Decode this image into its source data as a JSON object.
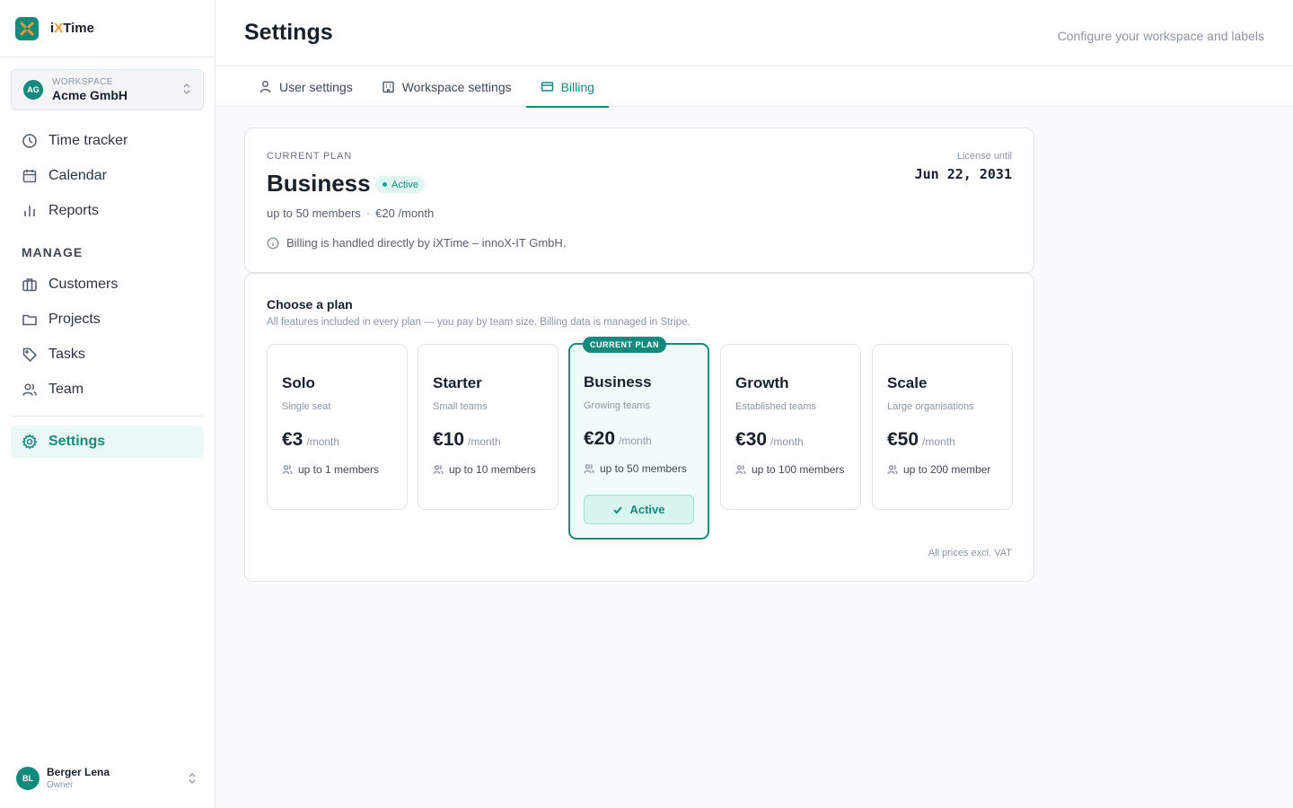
{
  "brand": {
    "prefix": "i",
    "x": "X",
    "suffix": "Time",
    "accent": "#f39a2c",
    "primary": "#148a7c"
  },
  "workspace": {
    "label": "WORKSPACE",
    "initials": "AG",
    "name": "Acme GmbH"
  },
  "nav": {
    "main": [
      {
        "label": "Time tracker",
        "icon": "clock-icon"
      },
      {
        "label": "Calendar",
        "icon": "calendar-icon"
      },
      {
        "label": "Reports",
        "icon": "bar-chart-icon"
      }
    ],
    "manage_label": "MANAGE",
    "manage": [
      {
        "label": "Customers",
        "icon": "briefcase-icon"
      },
      {
        "label": "Projects",
        "icon": "folder-icon"
      },
      {
        "label": "Tasks",
        "icon": "tag-icon"
      },
      {
        "label": "Team",
        "icon": "users-icon"
      }
    ],
    "settings": {
      "label": "Settings",
      "icon": "gear-icon",
      "active": true
    }
  },
  "user": {
    "initials": "BL",
    "name": "Berger Lena",
    "role": "Owner"
  },
  "header": {
    "title": "Settings",
    "subtitle": "Configure your workspace and labels"
  },
  "tabs": [
    {
      "label": "User settings",
      "icon": "user-icon"
    },
    {
      "label": "Workspace settings",
      "icon": "building-icon"
    },
    {
      "label": "Billing",
      "icon": "credit-card-icon",
      "active": true
    }
  ],
  "current_plan": {
    "label": "CURRENT PLAN",
    "name": "Business",
    "status": "Active",
    "members": "up to 50 members",
    "price": "€20 /month",
    "info": "Billing is handled directly by iXTime – innoX-IT GmbH.",
    "license_label": "License until",
    "license_date": "Jun 22, 2031"
  },
  "plans_section": {
    "title": "Choose a plan",
    "subtitle": "All features included in every plan — you pay by team size. Billing data is managed in Stripe.",
    "current_flag": "CURRENT PLAN",
    "active_button": "Active",
    "vat_note": "All prices excl. VAT",
    "plans": [
      {
        "name": "Solo",
        "desc": "Single seat",
        "price": "€3",
        "period": "/month",
        "members": "up to 1 members"
      },
      {
        "name": "Starter",
        "desc": "Small teams",
        "price": "€10",
        "period": "/month",
        "members": "up to 10 members"
      },
      {
        "name": "Business",
        "desc": "Growing teams",
        "price": "€20",
        "period": "/month",
        "members": "up to 50 members",
        "current": true
      },
      {
        "name": "Growth",
        "desc": "Established teams",
        "price": "€30",
        "period": "/month",
        "members": "up to 100 members"
      },
      {
        "name": "Scale",
        "desc": "Large organisations",
        "price": "€50",
        "period": "/month",
        "members": "up to 200 member"
      }
    ]
  }
}
